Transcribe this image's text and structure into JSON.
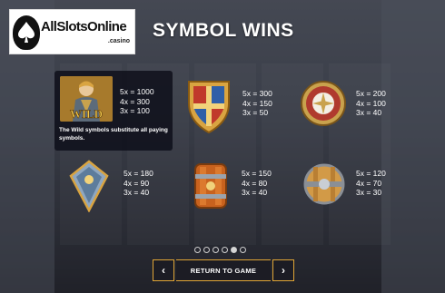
{
  "logo": {
    "text": "AllSlotsOnline",
    "sub": ".casino"
  },
  "title": "SYMBOL WINS",
  "wild": {
    "art_label": "WILD",
    "pays": "5x = 1000\n4x = 300\n3x = 100",
    "description": "The Wild symbols substitute all paying symbols."
  },
  "symbols": [
    {
      "name": "shield-red-blue-cross",
      "pays": "5x = 300\n4x = 150\n3x = 50"
    },
    {
      "name": "round-shield-red",
      "pays": "5x = 200\n4x = 100\n3x = 40"
    },
    {
      "name": "diamond-shield-blue",
      "pays": "5x = 180\n4x = 90\n3x = 40"
    },
    {
      "name": "wooden-shield-orange",
      "pays": "5x = 150\n4x = 80\n3x = 40"
    },
    {
      "name": "round-wooden-shield",
      "pays": "5x = 120\n4x = 70\n3x = 30"
    }
  ],
  "pagination": {
    "pages": 6,
    "active": 5
  },
  "nav": {
    "prev": "‹",
    "label": "RETURN TO GAME",
    "next": "›"
  },
  "colors": {
    "accent_border": "#e0a536",
    "button_bg": "#1c1c24"
  }
}
